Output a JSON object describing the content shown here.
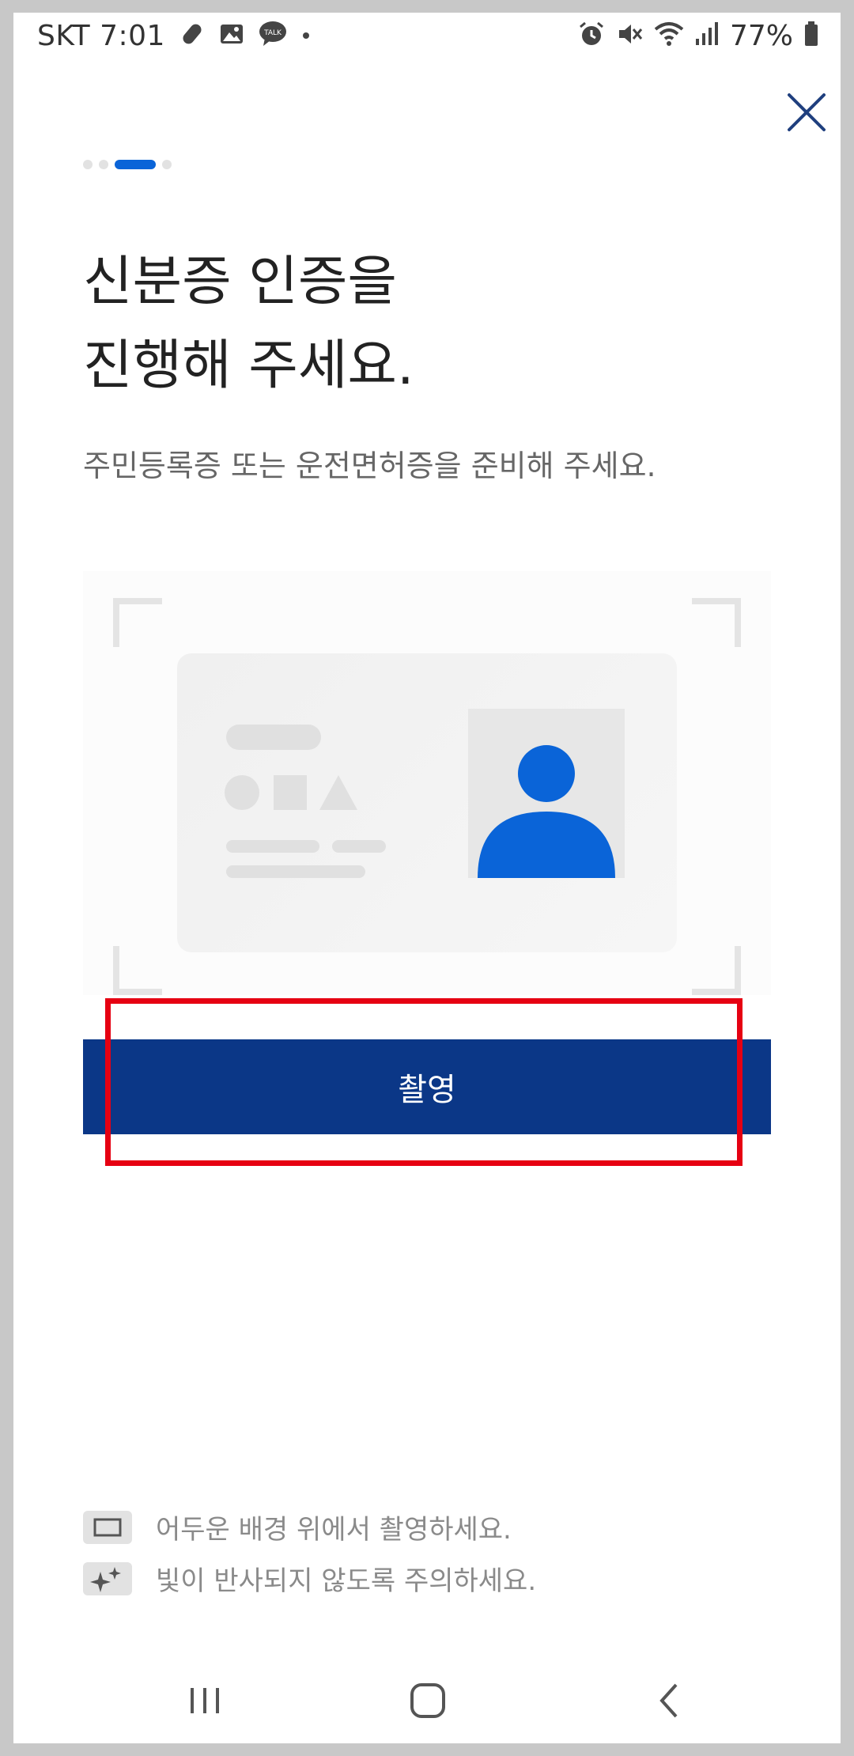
{
  "status_bar": {
    "carrier_time": "SKT 7:01",
    "battery_percent": "77%",
    "left_icons": [
      "medicine-icon",
      "gallery-icon",
      "kakaotalk-icon",
      "dot-icon"
    ],
    "kakaotalk_label": "TALK",
    "right_icons": [
      "alarm-icon",
      "mute-icon",
      "wifi-icon",
      "signal-icon",
      "battery-icon"
    ]
  },
  "progress": {
    "total_steps": 4,
    "current_step": 3
  },
  "header": {
    "title": "신분증 인증을\n진행해 주세요.",
    "subtitle": "주민등록증 또는 운전면허증을 준비해 주세요."
  },
  "capture_button_label": "촬영",
  "tips": [
    {
      "icon": "dark-background-icon",
      "text": "어두운 배경 위에서 촬영하세요."
    },
    {
      "icon": "glare-icon",
      "text": "빛이 반사되지 않도록 주의하세요."
    }
  ],
  "colors": {
    "accent": "#0a64d8",
    "primary_button": "#0b3787",
    "highlight": "#e60012"
  },
  "nav_bar": {
    "buttons": [
      "recent-apps",
      "home",
      "back"
    ]
  }
}
